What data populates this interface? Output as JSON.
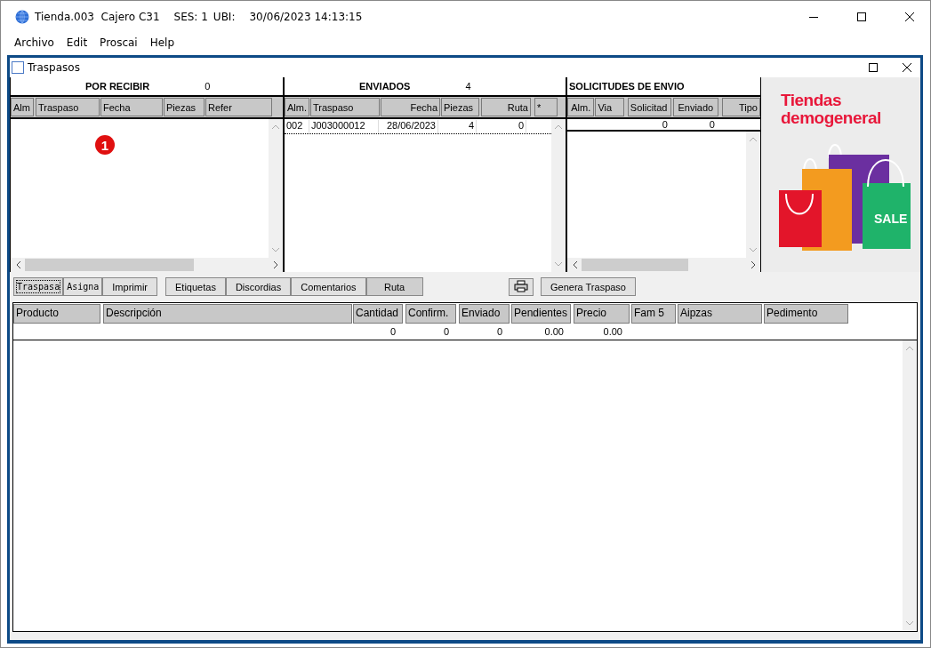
{
  "window": {
    "title": "Tienda.003  Cajero C31",
    "session": "SES: 1",
    "location": "UBI:",
    "datetime": "30/06/2023 14:13:15"
  },
  "menu": [
    "Archivo",
    "Edit",
    "Proscai",
    "Help"
  ],
  "child_window": {
    "title": "Traspasos"
  },
  "panels": [
    {
      "title": "POR RECIBIR",
      "count": "0",
      "columns": [
        {
          "label": "Alm"
        },
        {
          "label": "Traspaso"
        },
        {
          "label": "Fecha"
        },
        {
          "label": "Piezas"
        },
        {
          "label": "Refer"
        }
      ],
      "badge": "1"
    },
    {
      "title": "ENVIADOS",
      "count": "4",
      "columns": [
        {
          "label": "Alm."
        },
        {
          "label": "Traspaso"
        },
        {
          "label": "Fecha"
        },
        {
          "label": "Piezas"
        },
        {
          "label": "Ruta"
        },
        {
          "label": "*"
        }
      ],
      "rows": [
        [
          "002",
          "J003000012",
          "28/06/2023",
          "4",
          "0"
        ]
      ]
    },
    {
      "title": "SOLICITUDES DE ENVIO",
      "columns": [
        {
          "label": "Alm."
        },
        {
          "label": "Via"
        },
        {
          "label": "Solicitad",
          "total": "0"
        },
        {
          "label": "Enviado",
          "total": "0"
        },
        {
          "label": "Tipo"
        }
      ]
    }
  ],
  "banner": {
    "line_1": "Tiendas",
    "line_2": "demogeneral",
    "bag_text": "SALE"
  },
  "toolbar": [
    {
      "label": "Traspasa",
      "selected": true
    },
    {
      "label": "Asigna",
      "selected": false
    },
    {
      "label": "Imprimir",
      "selected": false
    },
    {
      "label": "Etiquetas",
      "selected": false
    },
    {
      "label": "Discordias",
      "selected": false
    },
    {
      "label": "Comentarios",
      "selected": false
    },
    {
      "label": "Ruta",
      "selected": false
    },
    {
      "label": "Genera Traspaso",
      "selected": false
    }
  ],
  "detail_table": {
    "columns": [
      {
        "label": "Producto"
      },
      {
        "label": "Descripción"
      },
      {
        "label": "Cantidad",
        "total": "0"
      },
      {
        "label": "Confirm.",
        "total": "0"
      },
      {
        "label": "Enviado",
        "total": "0"
      },
      {
        "label": "Pendientes",
        "total": "0.00"
      },
      {
        "label": "Precio",
        "total": "0.00"
      },
      {
        "label": "Fam 5"
      },
      {
        "label": "Aipzas"
      },
      {
        "label": "Pedimento"
      }
    ]
  }
}
